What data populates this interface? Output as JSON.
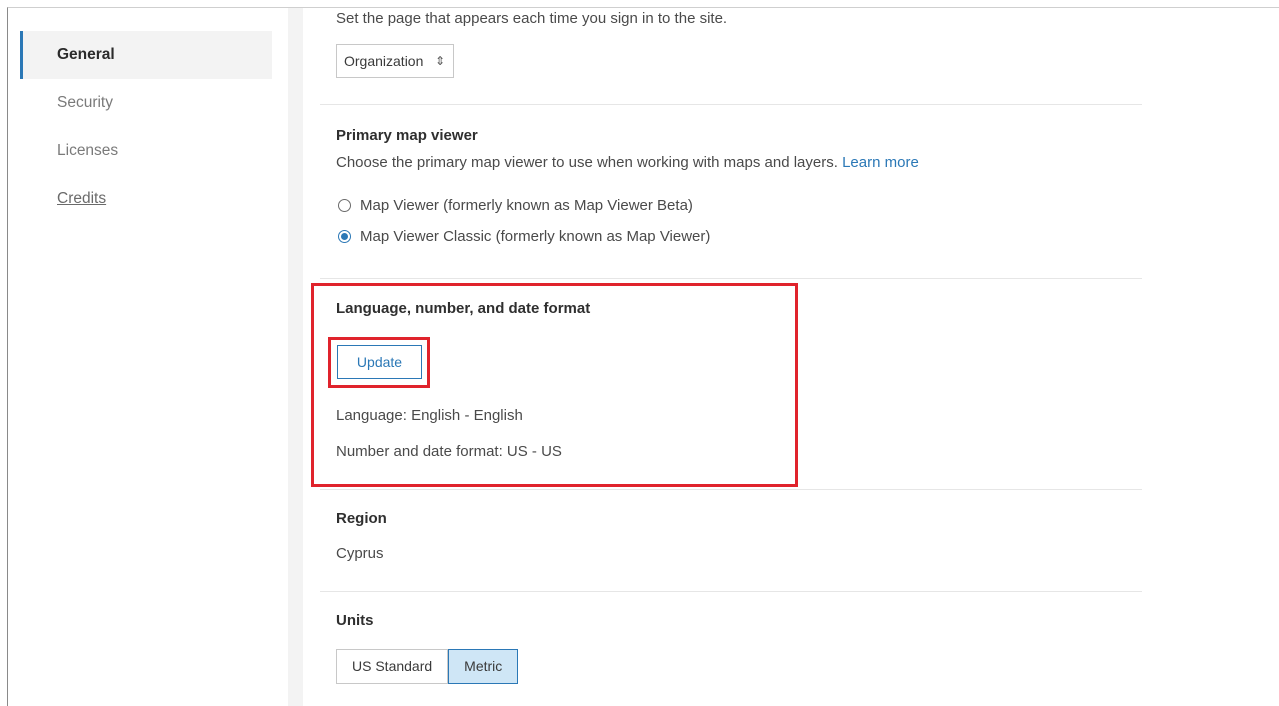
{
  "sidebar": {
    "items": [
      {
        "label": "General"
      },
      {
        "label": "Security"
      },
      {
        "label": "Licenses"
      },
      {
        "label": "Credits"
      }
    ]
  },
  "home_page": {
    "description": "Set the page that appears each time you sign in to the site.",
    "select_value": "Organization"
  },
  "map_viewer": {
    "title": "Primary map viewer",
    "description": "Choose the primary map viewer to use when working with maps and layers.",
    "learn_more": "Learn more",
    "options": [
      {
        "label": "Map Viewer (formerly known as Map Viewer Beta)",
        "checked": false
      },
      {
        "label": "Map Viewer Classic (formerly known as Map Viewer)",
        "checked": true
      }
    ]
  },
  "language": {
    "title": "Language, number, and date format",
    "update_label": "Update",
    "language_text": "Language: English - English",
    "format_text": "Number and date format: US - US"
  },
  "region": {
    "title": "Region",
    "value": "Cyprus"
  },
  "units": {
    "title": "Units",
    "options": [
      "US Standard",
      "Metric"
    ],
    "selected": "Metric"
  },
  "colors": {
    "accent": "#2b78b6",
    "highlight_box": "#e0232c"
  }
}
